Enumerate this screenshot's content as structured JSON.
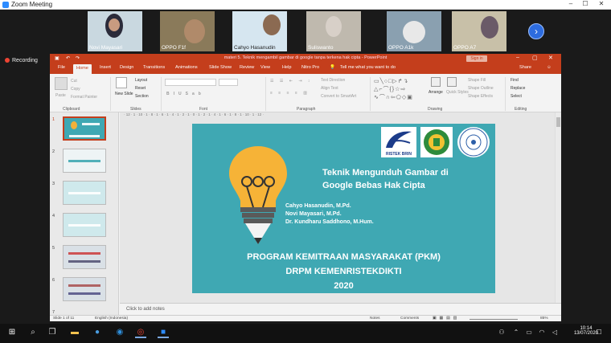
{
  "zoom": {
    "title": "Zoom Meeting",
    "recording": "Recording",
    "next_icon": "chevron-right-icon"
  },
  "participants": [
    {
      "name": "Novi Mayasari"
    },
    {
      "name": "OPPO F1f"
    },
    {
      "name": "Cahyo Hasanudin"
    },
    {
      "name": "Suliswanto"
    },
    {
      "name": "OPPO A1k"
    },
    {
      "name": "OPPO A7"
    }
  ],
  "ppt": {
    "title": "materi 5. Teknik mengambil gambar di google tanpa terkena hak cipta  -  PowerPoint",
    "sign_in": "Sign in",
    "share": "Share",
    "tell_me": "Tell me what you want to do",
    "tabs": [
      "File",
      "Home",
      "Insert",
      "Design",
      "Transitions",
      "Animations",
      "Slide Show",
      "Review",
      "View",
      "Help",
      "Nitro Pro"
    ],
    "ribbon": {
      "paste": "Paste",
      "cut": "Cut",
      "copy": "Copy",
      "format_painter": "Format Painter",
      "clipboard": "Clipboard",
      "new_slide": "New Slide",
      "layout": "Layout",
      "reset": "Reset",
      "section": "Section",
      "slides": "Slides",
      "font": "Font",
      "paragraph": "Paragraph",
      "text_direction": "Text Direction",
      "align_text": "Align Text",
      "convert_smartart": "Convert to SmartArt",
      "arrange": "Arrange",
      "quick_styles": "Quick Styles",
      "shape_fill": "Shape Fill",
      "shape_outline": "Shape Outline",
      "shape_effects": "Shape Effects",
      "drawing": "Drawing",
      "find": "Find",
      "replace": "Replace",
      "select": "Select",
      "editing": "Editing"
    },
    "thumbs": [
      "1",
      "2",
      "3",
      "4",
      "5",
      "6",
      "7"
    ],
    "notes_placeholder": "Click to add notes",
    "status": {
      "slide": "Slide 1 of 11",
      "language": "English (Indonesia)",
      "notes": "Notes",
      "comments": "Comments",
      "zoom": "85%"
    }
  },
  "slide": {
    "logo1": "RISTEK BRIN",
    "title": "Teknik Mengunduh Gambar di Google Bebas Hak Cipta",
    "title_line1": "Teknik Mengunduh Gambar di",
    "title_line2": "Google Bebas Hak Cipta",
    "authors": [
      "Cahyo Hasanudin, M.Pd.",
      "Novi Mayasari, M.Pd.",
      "Dr. Kundharu Saddhono, M.Hum."
    ],
    "footer1": "PROGRAM KEMITRAAN MASYARAKAT (PKM)",
    "footer2": "DRPM KEMENRISTEKDIKTI",
    "footer3": "2020"
  },
  "taskbar": {
    "time": "10:14",
    "date": "13/07/2020"
  }
}
